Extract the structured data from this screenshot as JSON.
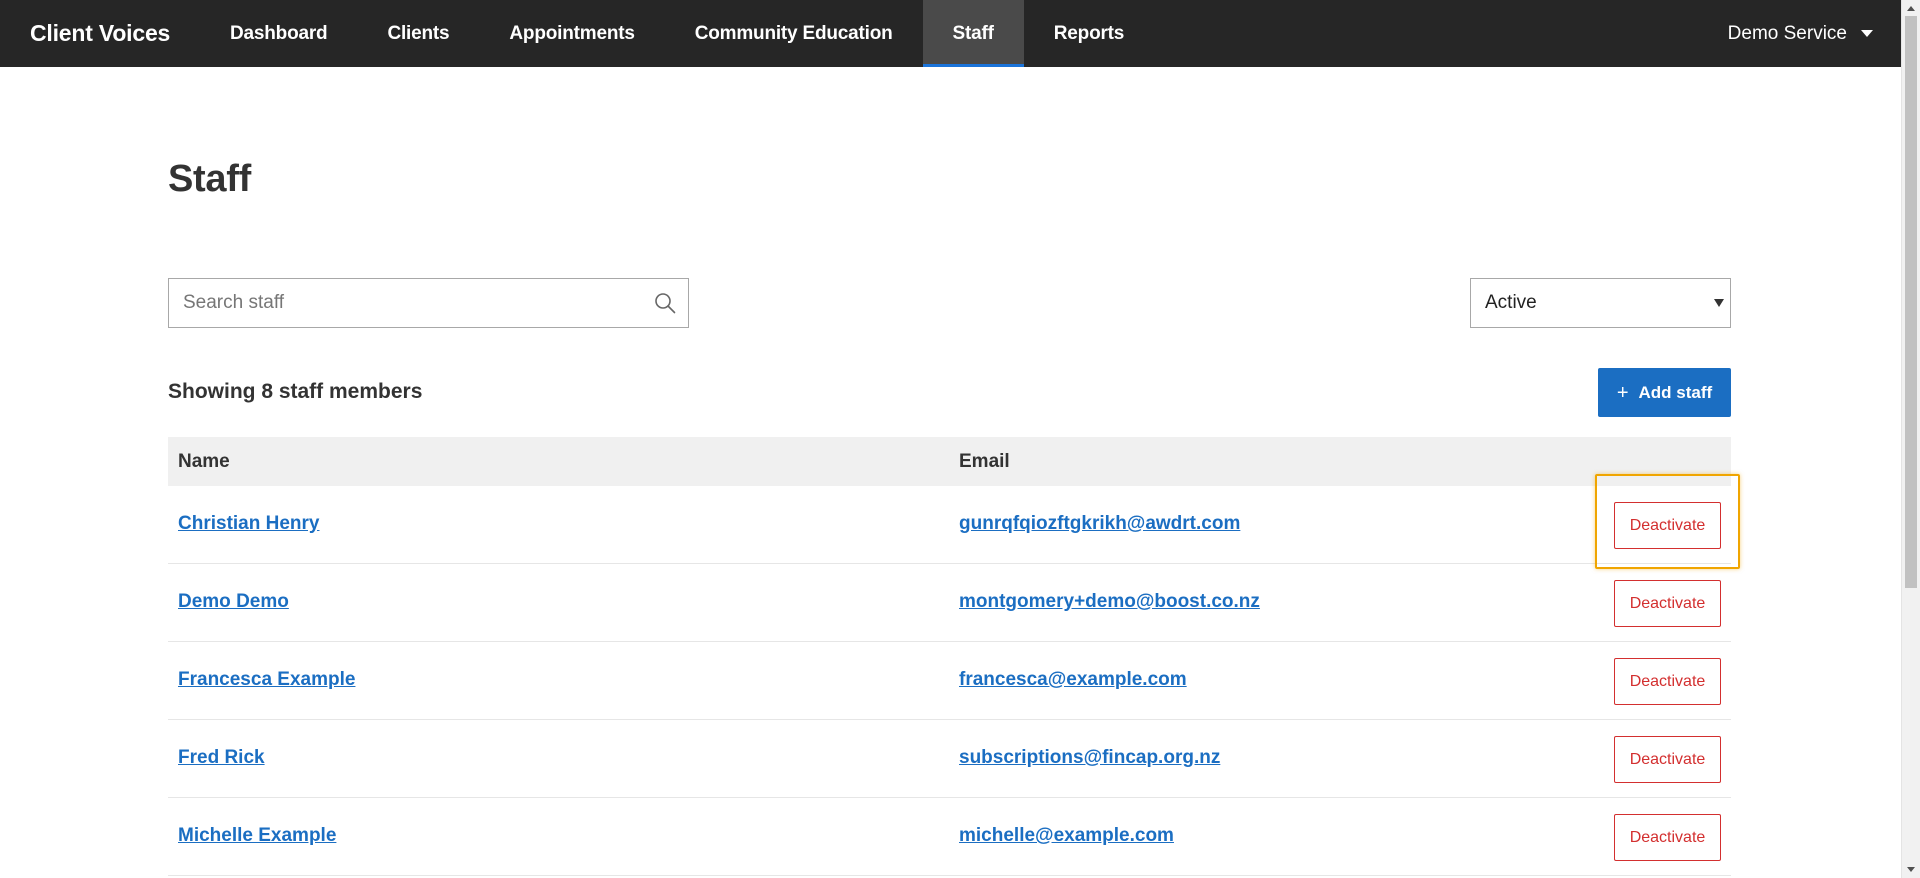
{
  "app": {
    "title": "Client Voices"
  },
  "nav": {
    "items": [
      {
        "label": "Dashboard",
        "active": false
      },
      {
        "label": "Clients",
        "active": false
      },
      {
        "label": "Appointments",
        "active": false
      },
      {
        "label": "Community Education",
        "active": false
      },
      {
        "label": "Staff",
        "active": true
      },
      {
        "label": "Reports",
        "active": false
      }
    ],
    "account_label": "Demo Service"
  },
  "page": {
    "title": "Staff"
  },
  "search": {
    "placeholder": "Search staff",
    "value": ""
  },
  "status_filter": {
    "selected": "Active"
  },
  "summary": {
    "showing": "Showing 8 staff members"
  },
  "add_button": {
    "label": "Add staff",
    "icon": "plus-icon"
  },
  "table": {
    "columns": [
      "Name",
      "Email",
      ""
    ],
    "rows": [
      {
        "name": "Christian Henry",
        "email": "gunrqfqiozftgkrikh@awdrt.com",
        "action": "Deactivate"
      },
      {
        "name": "Demo Demo",
        "email": "montgomery+demo@boost.co.nz",
        "action": "Deactivate"
      },
      {
        "name": "Francesca Example",
        "email": "francesca@example.com",
        "action": "Deactivate"
      },
      {
        "name": "Fred Rick",
        "email": "subscriptions@fincap.org.nz",
        "action": "Deactivate"
      },
      {
        "name": "Michelle Example",
        "email": "michelle@example.com",
        "action": "Deactivate"
      }
    ]
  },
  "colors": {
    "nav_bg": "#262626",
    "nav_active_bg": "#4a4a4a",
    "accent": "#1b6ec2",
    "danger": "#d32f2f",
    "highlight": "#f0a500",
    "table_header_bg": "#f0f0f0"
  }
}
